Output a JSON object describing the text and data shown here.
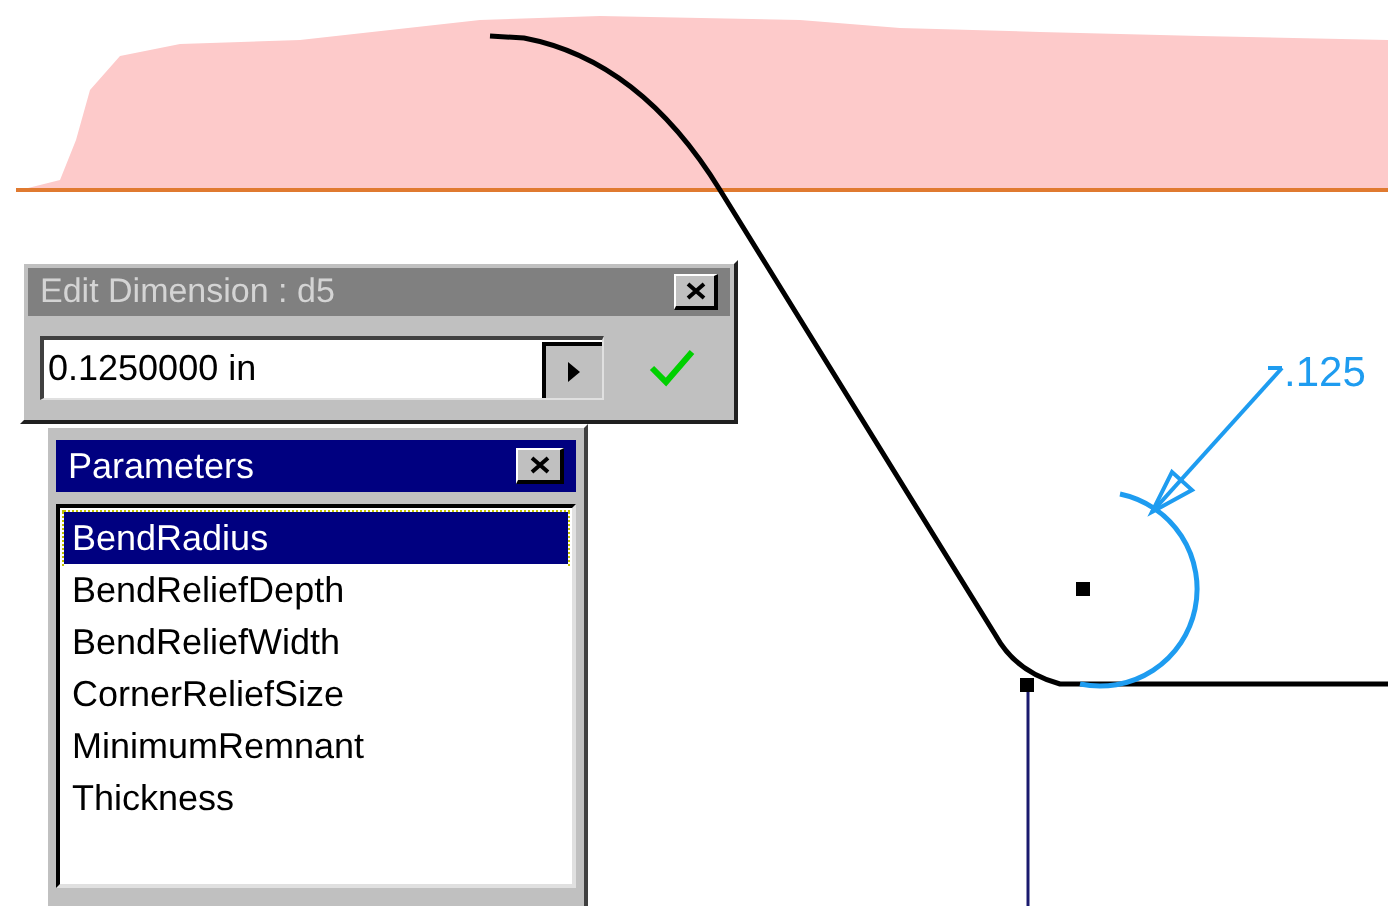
{
  "edit_dimension": {
    "title": "Edit Dimension : d5",
    "value": "0.1250000 in"
  },
  "parameters": {
    "title": "Parameters",
    "items": [
      {
        "label": "BendRadius",
        "selected": true
      },
      {
        "label": "BendReliefDepth",
        "selected": false
      },
      {
        "label": "BendReliefWidth",
        "selected": false
      },
      {
        "label": "CornerReliefSize",
        "selected": false
      },
      {
        "label": "MinimumRemnant",
        "selected": false
      },
      {
        "label": "Thickness",
        "selected": false
      }
    ]
  },
  "drawing": {
    "dimension_text": ".125"
  }
}
